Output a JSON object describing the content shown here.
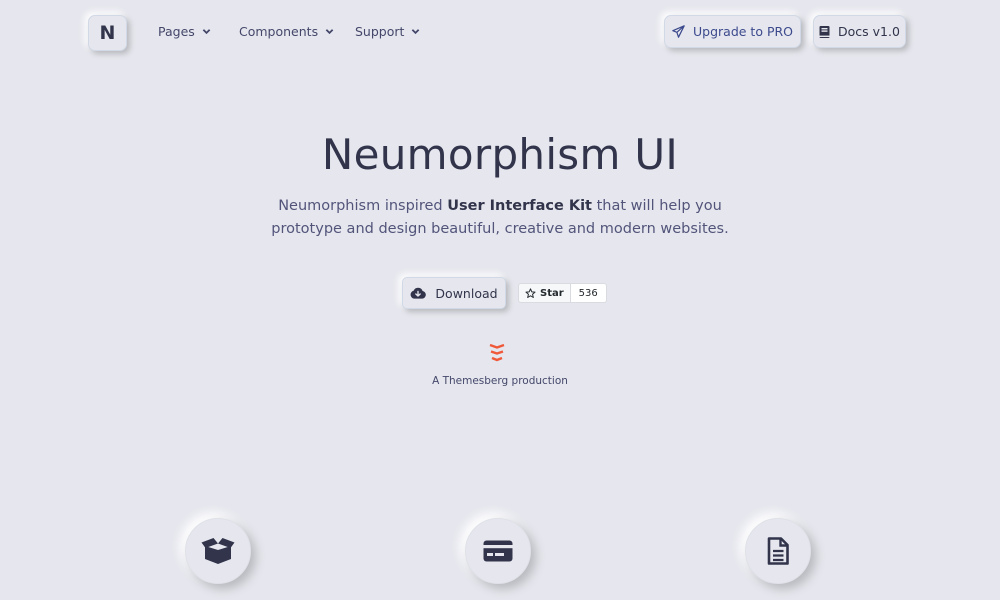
{
  "nav": {
    "brand": "N",
    "items": [
      {
        "label": "Pages",
        "icon": "chevron-down-icon"
      },
      {
        "label": "Components",
        "icon": "chevron-down-icon"
      },
      {
        "label": "Support",
        "icon": "chevron-down-icon"
      }
    ],
    "upgrade_label": "Upgrade to PRO",
    "docs_label": "Docs v1.0"
  },
  "hero": {
    "title": "Neumorphism UI",
    "subtitle_pre": "Neumorphism inspired ",
    "subtitle_bold": "User Interface Kit",
    "subtitle_post": " that will help you",
    "subtitle_line2": "prototype and design beautiful, creative and modern websites.",
    "download_label": "Download",
    "star_label": "Star",
    "star_count": "536",
    "production_text": "A Themesberg production"
  },
  "features": [
    {
      "icon": "box-open-icon"
    },
    {
      "icon": "credit-card-icon"
    },
    {
      "icon": "file-alt-icon"
    }
  ],
  "colors": {
    "background": "#e6e7ee",
    "text": "#44476a",
    "accent": "#3c4a8d",
    "themesberg": "#f0583a"
  }
}
